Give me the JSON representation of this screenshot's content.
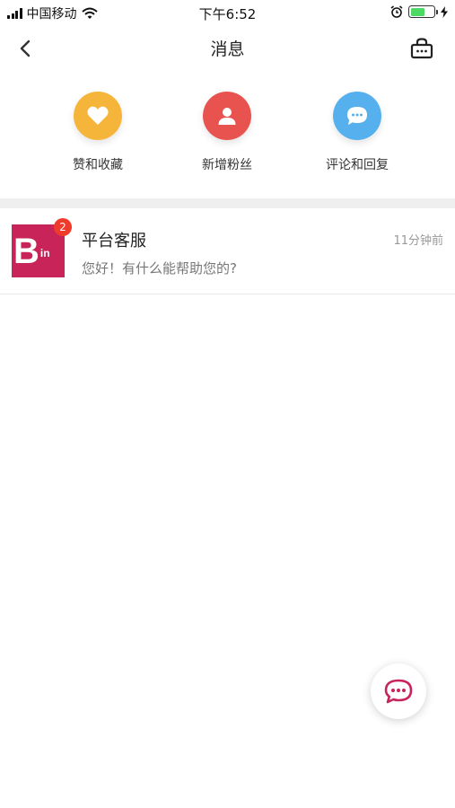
{
  "status_bar": {
    "carrier": "中国移动",
    "time": "下午6:52",
    "icons": [
      "signal-icon",
      "wifi-icon",
      "alarm-icon",
      "battery-icon",
      "charging-icon"
    ]
  },
  "nav": {
    "title": "消息",
    "back_icon": "chevron-left-icon",
    "right_icon": "shopping-bag-icon"
  },
  "categories": [
    {
      "label": "赞和收藏",
      "icon": "heart-icon",
      "color": "#f5b53b"
    },
    {
      "label": "新增粉丝",
      "icon": "person-icon",
      "color": "#e8524f"
    },
    {
      "label": "评论和回复",
      "icon": "chat-bubble-icon",
      "color": "#56b0ee"
    }
  ],
  "messages": [
    {
      "title": "平台客服",
      "time": "11分钟前",
      "preview": "您好！有什么能帮助您的?",
      "badge": "2",
      "avatar_text": "B",
      "avatar_sub": "in",
      "avatar_color": "#c8245a"
    }
  ],
  "floating_button": {
    "icon": "chat-icon",
    "color": "#c8245a"
  }
}
